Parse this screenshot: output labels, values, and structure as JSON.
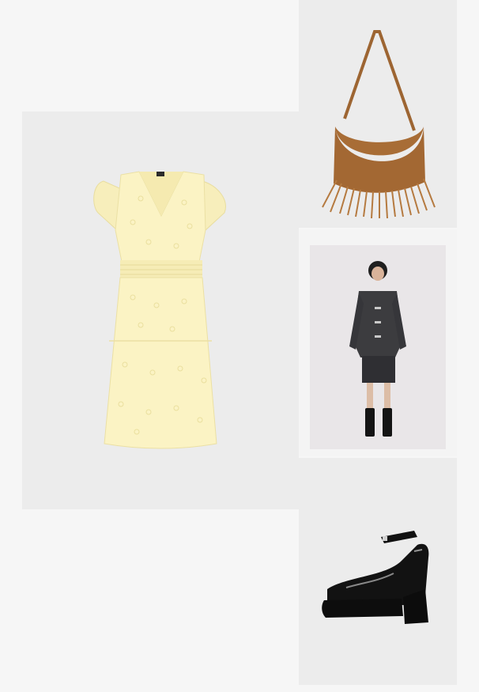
{
  "grid": {
    "items": [
      {
        "name": "yellow-eyelet-dress",
        "icon": "dress-image"
      },
      {
        "name": "suede-fringe-bag",
        "icon": "bag-image"
      },
      {
        "name": "tweed-jacket-skirt-look",
        "icon": "model-image"
      },
      {
        "name": "patent-platform-pumps",
        "icon": "shoe-image"
      }
    ]
  },
  "colors": {
    "background": "#f6f6f6",
    "tile": "#ececec",
    "dress": "#fbf3c4",
    "bag": "#a86d36",
    "jacket": "#3c3c3f",
    "shoe": "#111111"
  }
}
